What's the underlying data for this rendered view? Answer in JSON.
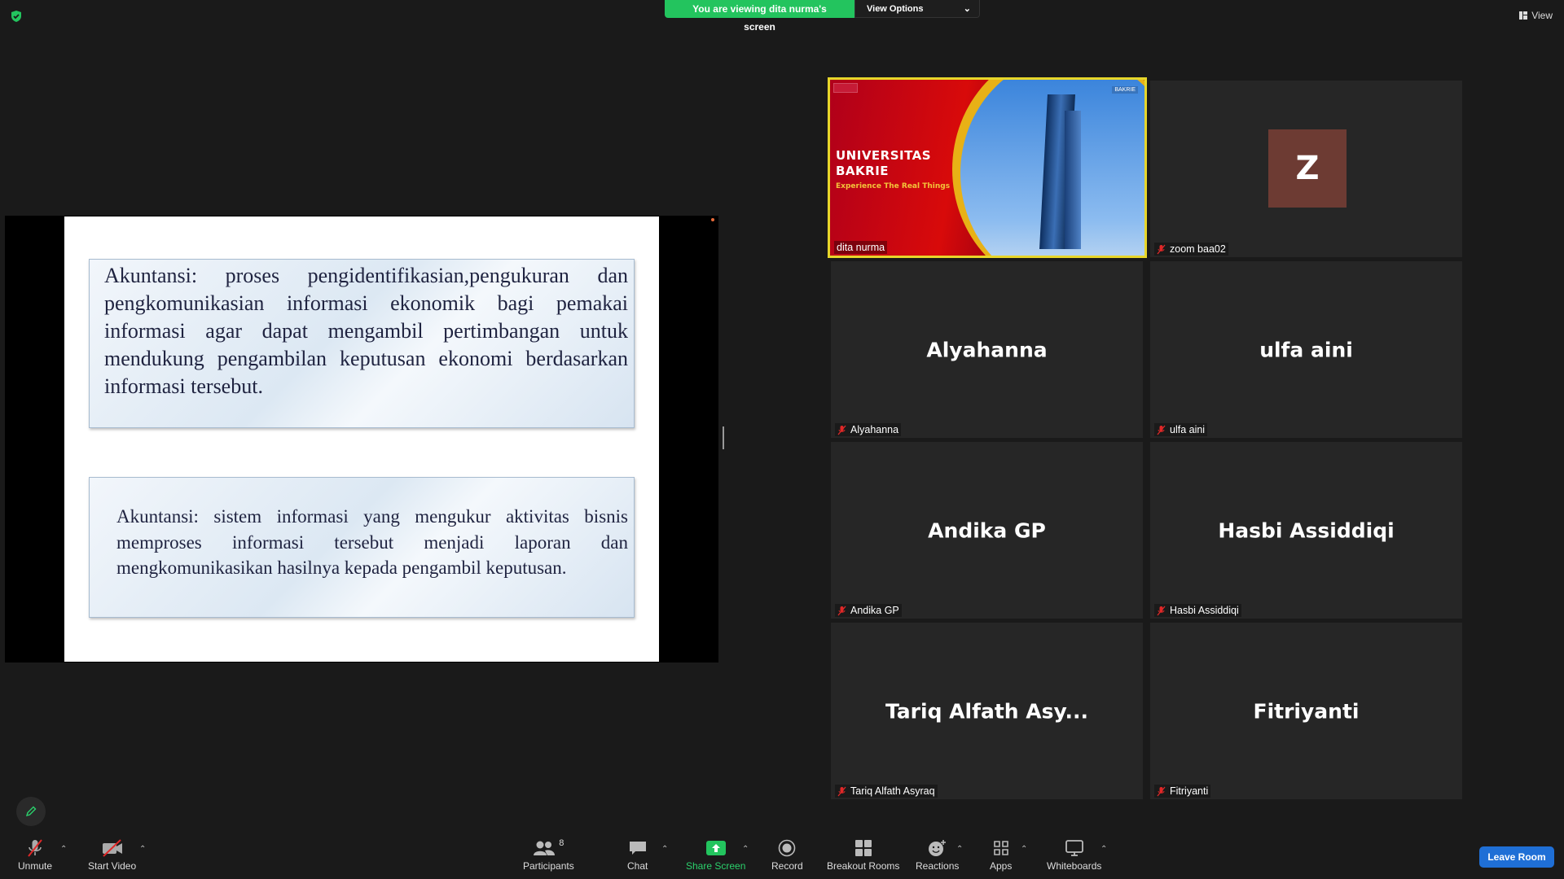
{
  "banner": {
    "viewing_text": "You are viewing dita nurma's screen",
    "view_options_label": "View Options",
    "view_top_label": "View"
  },
  "slide": {
    "box1_text": "Akuntansi: proses pengidentifikasian,pengukuran dan pengkomunikasian informasi ekonomik  bagi pemakai informasi agar dapat mengambil pertimbangan untuk mendukung pengambilan keputusan ekonomi berdasarkan informasi tersebut.",
    "box2_text": "Akuntansi: sistem informasi yang mengukur aktivitas bisnis memproses informasi tersebut menjadi laporan dan mengkomunikasikan hasilnya kepada pengambil keputusan."
  },
  "gallery": {
    "active_video": {
      "title": "UNIVERSITAS BAKRIE",
      "subtitle": "Experience The Real Things",
      "logo": "BAKRIE",
      "label": "dita nurma"
    },
    "tiles": [
      {
        "display": "Z",
        "label": "zoom baa02"
      },
      {
        "display": "Alyahanna",
        "label": "Alyahanna"
      },
      {
        "display": "ulfa aini",
        "label": "ulfa aini"
      },
      {
        "display": "Andika GP",
        "label": "Andika GP"
      },
      {
        "display": "Hasbi Assiddiqi",
        "label": "Hasbi Assiddiqi"
      },
      {
        "display": "Tariq Alfath Asy...",
        "label": "Tariq Alfath Asyraq"
      },
      {
        "display": "Fitriyanti",
        "label": "Fitriyanti"
      }
    ]
  },
  "toolbar": {
    "unmute": "Unmute",
    "start_video": "Start Video",
    "participants": "Participants",
    "participant_count": "8",
    "chat": "Chat",
    "share_screen": "Share Screen",
    "record": "Record",
    "breakout_rooms": "Breakout Rooms",
    "reactions": "Reactions",
    "apps": "Apps",
    "whiteboards": "Whiteboards",
    "leave_room": "Leave Room"
  },
  "colors": {
    "banner_green": "#23c45e",
    "leave_blue": "#1f6fd6",
    "active_speaker_border": "#e7d62a",
    "muted_red": "#e02828"
  }
}
